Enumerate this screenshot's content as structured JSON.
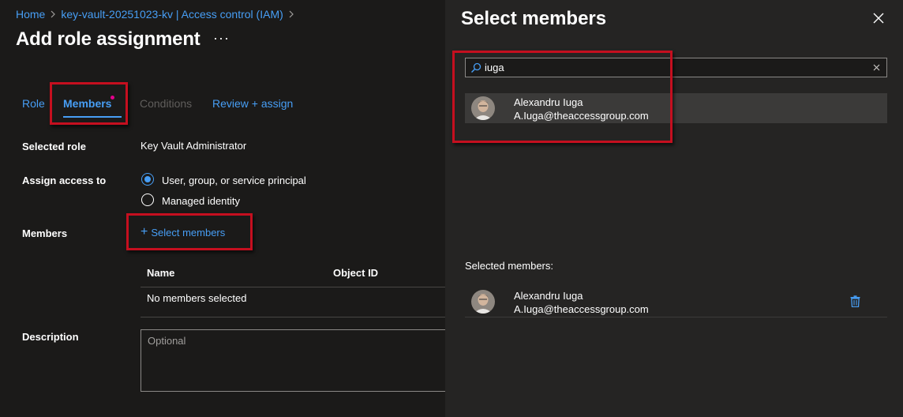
{
  "breadcrumb": {
    "items": [
      "Home",
      "key-vault-20251023-kv | Access control (IAM)"
    ],
    "separator": ">"
  },
  "page": {
    "title": "Add role assignment",
    "more_label": "···"
  },
  "tabs": [
    {
      "label": "Role",
      "state": "link"
    },
    {
      "label": "Members",
      "state": "active"
    },
    {
      "label": "Conditions",
      "state": "disabled"
    },
    {
      "label": "Review + assign",
      "state": "link"
    }
  ],
  "form": {
    "selected_role_label": "Selected role",
    "selected_role_value": "Key Vault Administrator",
    "assign_access_label": "Assign access to",
    "assign_options": [
      {
        "label": "User, group, or service principal",
        "checked": true
      },
      {
        "label": "Managed identity",
        "checked": false
      }
    ],
    "members_label": "Members",
    "select_members_plus": "+",
    "select_members_label": "Select members",
    "table": {
      "columns": [
        "Name",
        "Object ID"
      ],
      "empty_text": "No members selected"
    },
    "description_label": "Description",
    "description_placeholder": "Optional"
  },
  "panel": {
    "title": "Select members",
    "search_value": "iuga",
    "results": [
      {
        "name": "Alexandru Iuga",
        "email": "A.Iuga@theaccessgroup.com"
      }
    ],
    "selected_heading": "Selected members:",
    "selected": [
      {
        "name": "Alexandru Iuga",
        "email": "A.Iuga@theaccessgroup.com"
      }
    ]
  },
  "colors": {
    "background": "#1b1a19",
    "panel": "#252423",
    "accent": "#479ef5",
    "highlight_box": "#c50f1f",
    "notification_dot": "#e3008c"
  },
  "icons": {
    "search": "search-icon",
    "clear": "clear-icon",
    "close": "close-icon",
    "delete": "trash-icon",
    "chevron": "chevron-right-icon"
  }
}
